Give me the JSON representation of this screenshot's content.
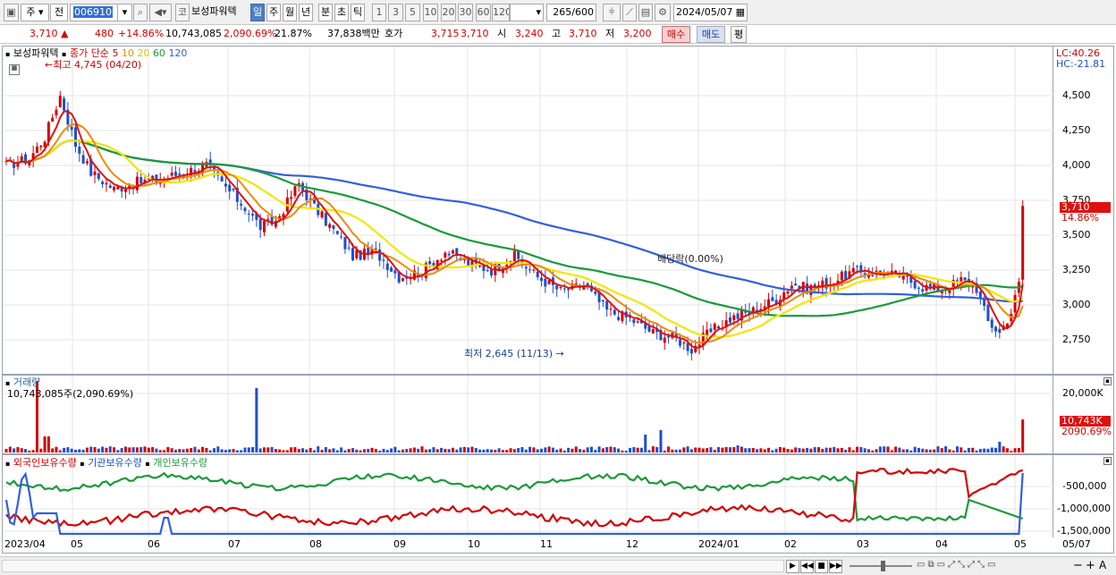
{
  "toolbar": {
    "market_select": "주",
    "prev_label": "전",
    "stock_code": "006910",
    "search_icon": "search-icon",
    "sound_icon": "speaker-icon",
    "code_label": "코",
    "stock_name": "보성파워텍",
    "period_tabs": [
      "일",
      "주",
      "월",
      "년",
      "분",
      "초",
      "틱"
    ],
    "active_period": "일",
    "interval_buttons": [
      "1",
      "3",
      "5",
      "10",
      "20",
      "30",
      "60",
      "120"
    ],
    "count_value": "265",
    "count_total": "/600",
    "date_value": "2024/05/07"
  },
  "quote": {
    "price": "3,710",
    "change_arrow": "▲",
    "change": "480",
    "change_pct": "+14.86%",
    "volume": "10,743,085",
    "volume_pct": "2,090.69%",
    "turnover": "21.87%",
    "amount": "37,838백만",
    "ask_label": "호가",
    "ask": "3,715",
    "bid": "3,710",
    "open_label": "시",
    "open": "3,240",
    "high_label": "고",
    "high": "3,710",
    "low_label": "저",
    "low": "3,200",
    "buy_button": "매수",
    "sell_button": "매도",
    "eval_button": "평"
  },
  "price_pane": {
    "legend_name": "보성파워텍",
    "legend_ma_label": "종가 단순",
    "ma_periods": [
      "5",
      "10",
      "20",
      "60",
      "120"
    ],
    "high_annotation": "최고 4,745 (04/20)",
    "low_annotation": "최저 2,645 (11/13)",
    "dividend_annotation": "배당락(0.00%)",
    "lc": "LC:40.26",
    "hc": "HC:-21.81",
    "y_ticks": [
      "4,500",
      "4,250",
      "4,000",
      "3,750",
      "3,500",
      "3,250",
      "3,000",
      "2,750"
    ],
    "last_price_tag": "3,710",
    "last_pct_tag": "14.86%"
  },
  "volume_pane": {
    "title": "거래량",
    "value_text": "10,743,085주(2,090.69%)",
    "y_ticks": [
      "20,000K"
    ],
    "last_tag": "10,743K",
    "last_pct_tag": "2090.69%"
  },
  "holdings_pane": {
    "legend": [
      "외국인보유수량",
      "기관보유수량",
      "개인보유수량"
    ],
    "y_ticks": [
      "-500,000",
      "-1,000,000",
      "-1,500,000"
    ]
  },
  "x_axis": {
    "labels": [
      "2023/04",
      "05",
      "06",
      "07",
      "08",
      "09",
      "10",
      "11",
      "12",
      "2024/01",
      "02",
      "03",
      "04",
      "05"
    ],
    "right_label": "05/07"
  },
  "colors": {
    "up": "#d50000",
    "down": "#1f4fd0",
    "ma5": "#e01010",
    "ma10": "#f08a00",
    "ma20": "#f2e600",
    "ma60": "#1a9a3a",
    "ma120": "#3060e0"
  }
}
